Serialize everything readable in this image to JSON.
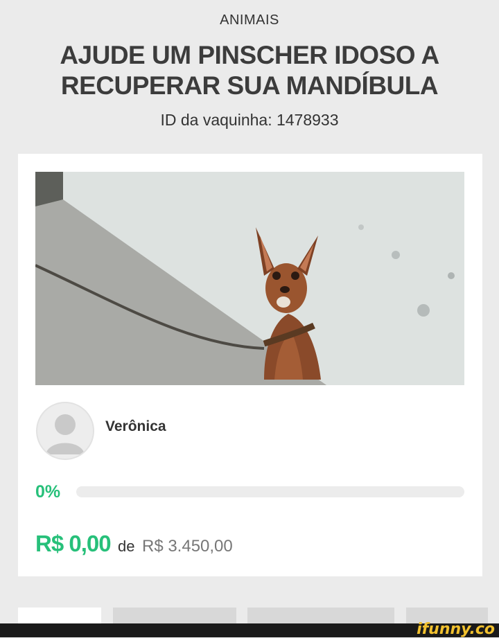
{
  "header": {
    "category": "ANIMAIS",
    "title": "AJUDE UM PINSCHER IDOSO A RECUPERAR SUA MANDÍBULA",
    "campaign_id_label": "ID da vaquinha: 1478933"
  },
  "card": {
    "photo_icon": "campaign-photo",
    "owner": {
      "name": "Verônica",
      "avatar_icon": "user-avatar-icon"
    },
    "progress": {
      "percent_label": "0%",
      "fraction": 0.0,
      "color": "#27c07a"
    },
    "raised": "R$ 0,00",
    "of_word": "de",
    "goal": "R$ 3.450,00"
  },
  "footer": {
    "watermark": "ifunny.co"
  },
  "colors": {
    "accent": "#27c07a",
    "background": "#ebebeb",
    "card": "#ffffff"
  }
}
